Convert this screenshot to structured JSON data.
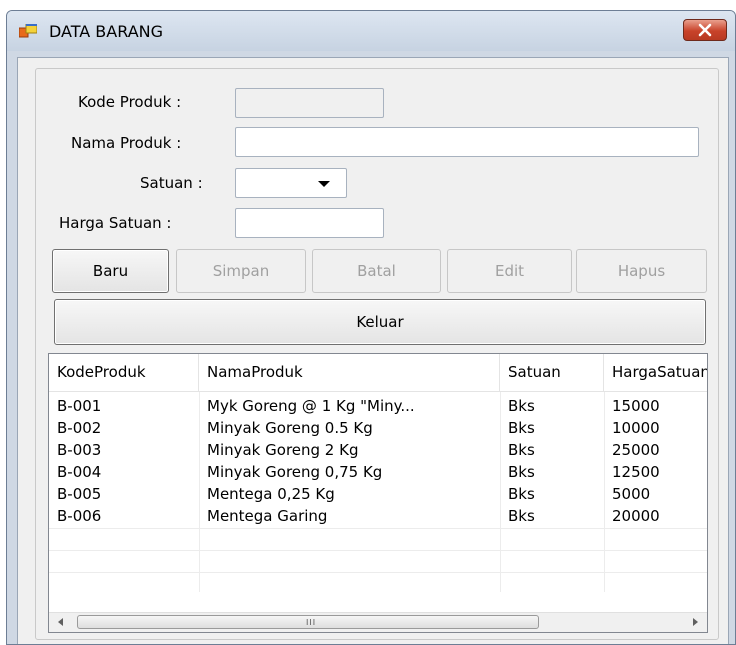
{
  "window": {
    "title": "DATA BARANG"
  },
  "form": {
    "kode_label": "Kode Produk :",
    "nama_label": "Nama Produk :",
    "satuan_label": "Satuan :",
    "harga_label": "Harga Satuan :",
    "kode_value": "",
    "nama_value": "",
    "satuan_value": "",
    "harga_value": ""
  },
  "buttons": {
    "baru": "Baru",
    "simpan": "Simpan",
    "batal": "Batal",
    "edit": "Edit",
    "hapus": "Hapus",
    "keluar": "Keluar"
  },
  "grid": {
    "columns": [
      "KodeProduk",
      "NamaProduk",
      "Satuan",
      "HargaSatuan"
    ],
    "rows": [
      [
        "B-001",
        "Myk Goreng @ 1 Kg \"Miny...",
        "Bks",
        "15000"
      ],
      [
        "B-002",
        "Minyak Goreng 0.5 Kg",
        "Bks",
        "10000"
      ],
      [
        "B-003",
        "Minyak Goreng 2 Kg",
        "Bks",
        "25000"
      ],
      [
        "B-004",
        "Minyak Goreng 0,75 Kg",
        "Bks",
        "12500"
      ],
      [
        "B-005",
        "Mentega 0,25 Kg",
        "Bks",
        "5000"
      ],
      [
        "B-006",
        "Mentega Garing",
        "Bks",
        "20000"
      ]
    ],
    "scroll_grip": "III"
  },
  "colors": {
    "close_red": "#c8432a",
    "titlebar": "#cfd8e4"
  },
  "icons": {
    "app": "window-app-icon",
    "close": "close-x-icon"
  }
}
